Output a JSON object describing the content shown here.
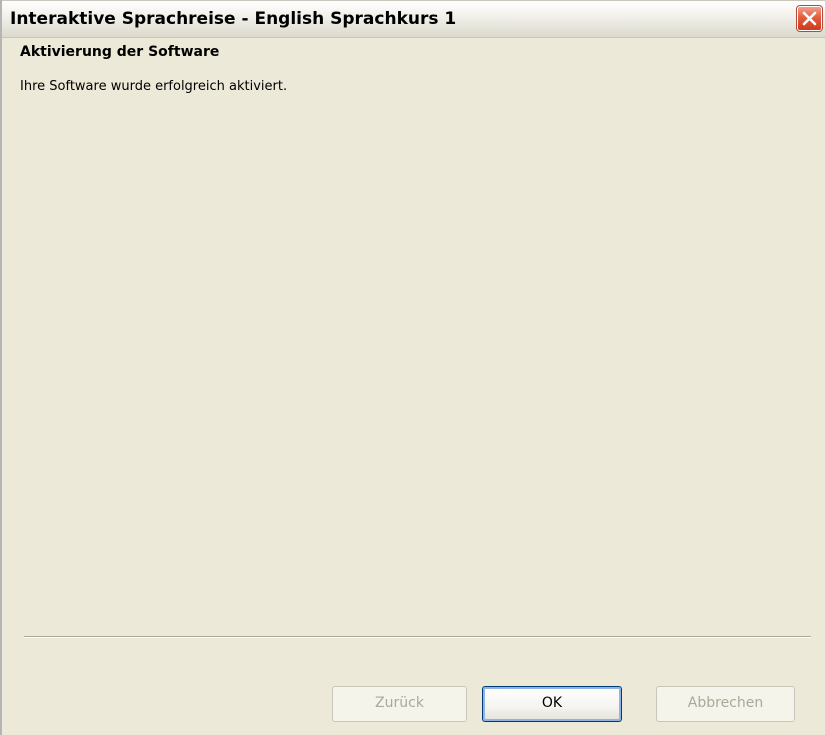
{
  "window": {
    "title": "Interaktive Sprachreise - English Sprachkurs 1",
    "close_icon": "close-icon"
  },
  "main": {
    "heading": "Aktivierung der Software",
    "message": "Ihre Software wurde erfolgreich aktiviert."
  },
  "buttons": {
    "back_label": "Zurück",
    "ok_label": "OK",
    "cancel_label": "Abbrechen"
  },
  "colors": {
    "close_button": "#e04a2c",
    "ok_focus_border": "#003c74",
    "disabled_text": "#aca899"
  }
}
